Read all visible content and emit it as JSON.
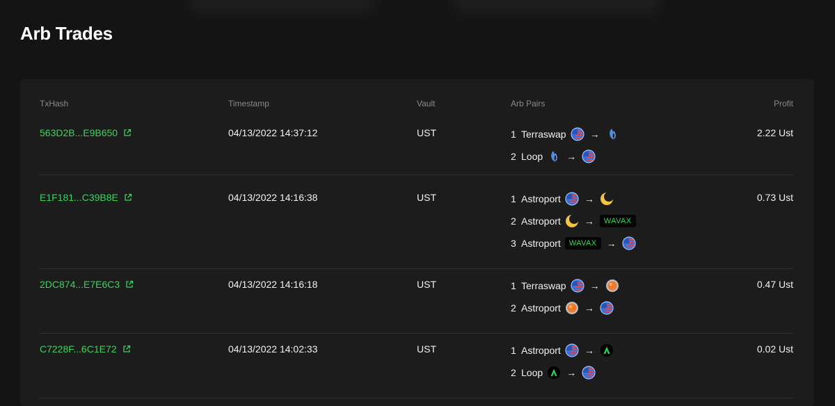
{
  "page": {
    "title": "Arb Trades"
  },
  "colors": {
    "accent": "#3ed15f",
    "background": "#141414",
    "card": "#1c1c1c",
    "divider": "#2f2f2f"
  },
  "table": {
    "headers": {
      "txhash": "TxHash",
      "timestamp": "Timestamp",
      "vault": "Vault",
      "arb_pairs": "Arb Pairs",
      "profit": "Profit"
    },
    "arrow": "→",
    "rows": [
      {
        "txhash": "563D2B...E9B650",
        "timestamp": "04/13/2022 14:37:12",
        "vault": "UST",
        "profit": "2.22 Ust",
        "pairs": [
          {
            "step": "1",
            "dex": "Terraswap",
            "from": "ust-flag-icon",
            "to": "flame-icon"
          },
          {
            "step": "2",
            "dex": "Loop",
            "from": "flame-icon",
            "to": "ust-flag-icon"
          }
        ]
      },
      {
        "txhash": "E1F181...C39B8E",
        "timestamp": "04/13/2022 14:16:38",
        "vault": "UST",
        "profit": "0.73 Ust",
        "pairs": [
          {
            "step": "1",
            "dex": "Astroport",
            "from": "ust-flag-icon",
            "to": "luna-icon"
          },
          {
            "step": "2",
            "dex": "Astroport",
            "from": "luna-icon",
            "to": "WAVAX"
          },
          {
            "step": "3",
            "dex": "Astroport",
            "from": "WAVAX",
            "to": "ust-flag-icon"
          }
        ]
      },
      {
        "txhash": "2DC874...E7E6C3",
        "timestamp": "04/13/2022 14:16:18",
        "vault": "UST",
        "profit": "0.47 Ust",
        "pairs": [
          {
            "step": "1",
            "dex": "Terraswap",
            "from": "ust-flag-icon",
            "to": "orange-coin-icon"
          },
          {
            "step": "2",
            "dex": "Astroport",
            "from": "orange-coin-icon",
            "to": "ust-flag-icon"
          }
        ]
      },
      {
        "txhash": "C7228F...6C1E72",
        "timestamp": "04/13/2022 14:02:33",
        "vault": "UST",
        "profit": "0.02 Ust",
        "pairs": [
          {
            "step": "1",
            "dex": "Astroport",
            "from": "ust-flag-icon",
            "to": "green-a-icon"
          },
          {
            "step": "2",
            "dex": "Loop",
            "from": "green-a-icon",
            "to": "ust-flag-icon"
          }
        ]
      }
    ]
  }
}
